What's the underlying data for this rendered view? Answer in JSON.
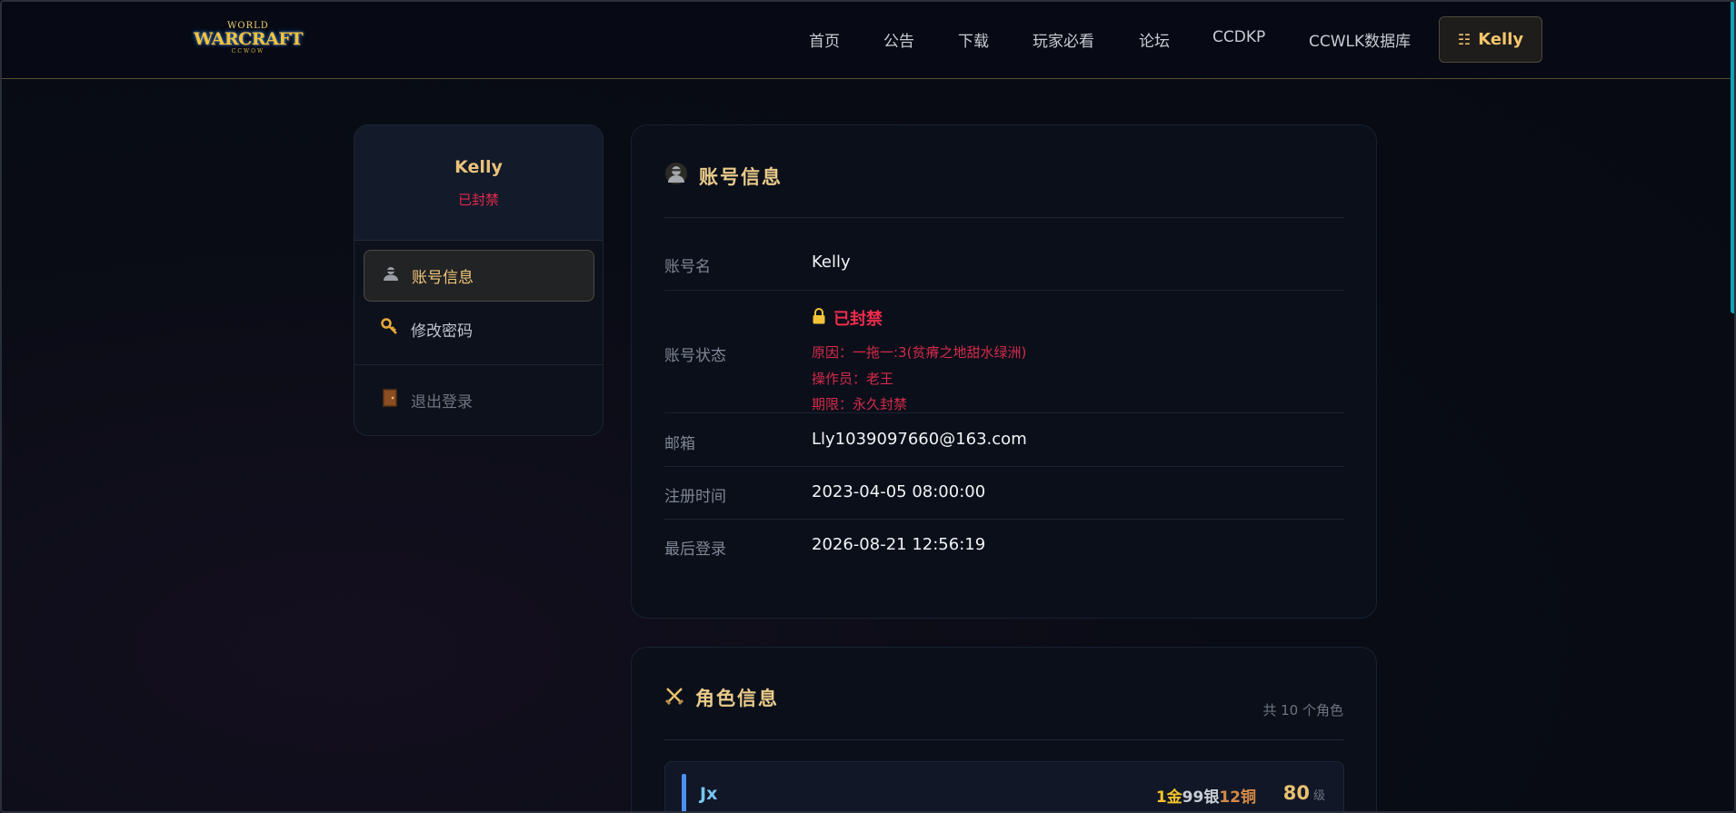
{
  "header": {
    "logo": {
      "top": "WORLD",
      "main": "WARCRAFT",
      "sub": "CCWOW"
    },
    "nav": [
      "首页",
      "公告",
      "下载",
      "玩家必看",
      "论坛",
      "CCDKP",
      "CCWLK数据库"
    ],
    "user_button": {
      "icon": "menu-icon",
      "label": "Kelly"
    }
  },
  "sidebar": {
    "username": "Kelly",
    "status": "已封禁",
    "items": [
      {
        "icon": "account-avatar-icon",
        "label": "账号信息",
        "active": true
      },
      {
        "icon": "key-icon",
        "label": "修改密码",
        "active": false
      }
    ],
    "logout": {
      "icon": "door-icon",
      "label": "退出登录"
    }
  },
  "account": {
    "title": "账号信息",
    "title_icon": "account-avatar-icon",
    "rows": {
      "name": {
        "label": "账号名",
        "value": "Kelly"
      },
      "status": {
        "label": "账号状态",
        "value": "已封禁",
        "icon": "lock-icon",
        "reason": "原因：一拖一:3(贫瘠之地甜水绿洲)",
        "operator": "操作员：老王",
        "term": "期限：永久封禁"
      },
      "email": {
        "label": "邮箱",
        "value": "Lly1039097660@163.com"
      },
      "registered": {
        "label": "注册时间",
        "value": "2023-04-05 08:00:00"
      },
      "last_login": {
        "label": "最后登录",
        "value": "2026-08-21 12:56:19"
      }
    }
  },
  "characters": {
    "title": "角色信息",
    "title_icon": "crossed-swords-icon",
    "count_text": "共 10 个角色",
    "list": [
      {
        "name": "Jx",
        "gold": "1金",
        "silver": "99银",
        "copper": "12铜",
        "level": "80",
        "level_unit": "级"
      }
    ]
  },
  "colors": {
    "accent_gold": "#eacb8a",
    "danger": "#ef2c4d",
    "scrollbar": "#0fa3b8",
    "class_bar": "#4b8ef7"
  }
}
